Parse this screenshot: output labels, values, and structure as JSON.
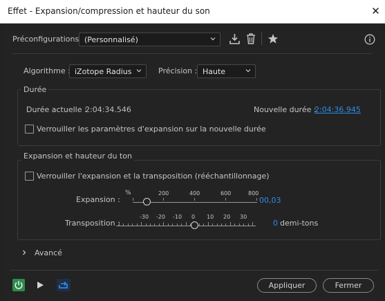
{
  "window": {
    "title": "Effet - Expansion/compression et hauteur du son",
    "close_glyph": "✕"
  },
  "presets": {
    "label": "Préconfigurations :",
    "value": "(Personnalisé)"
  },
  "algorithm": {
    "label": "Algorithme :",
    "value": "iZotope Radius"
  },
  "precision": {
    "label": "Précision :",
    "value": "Haute"
  },
  "duration": {
    "group_title": "Durée",
    "current_label": "Durée actuelle :",
    "current_value": "2:04:34.546",
    "new_label": "Nouvelle durée :",
    "new_value": "2:04:36.945",
    "lock_label": "Verrouiller les paramètres d'expansion sur la nouvelle durée",
    "lock_checked": false
  },
  "pitch": {
    "group_title": "Expansion et hauteur du ton",
    "lock_label": "Verrouiller l'expansion et la transposition (rééchantillonnage)",
    "lock_checked": false,
    "expansion": {
      "label": "Expansion :",
      "unit": "%",
      "ticks": [
        "200",
        "400",
        "600",
        "800"
      ],
      "value": "00,03",
      "slider_level": 0.0
    },
    "transposition": {
      "label": "Transposition :",
      "ticks": [
        "-30",
        "-20",
        "-10",
        "0",
        "10",
        "20",
        "30"
      ],
      "value": "0",
      "unit": "demi-tons",
      "slider_level": 0.5
    }
  },
  "advanced": {
    "label": "Avancé"
  },
  "footer": {
    "apply_label": "Appliquer",
    "close_label": "Fermer"
  },
  "colors": {
    "accent": "#2d8ceb",
    "power": "#2e8b4b"
  }
}
